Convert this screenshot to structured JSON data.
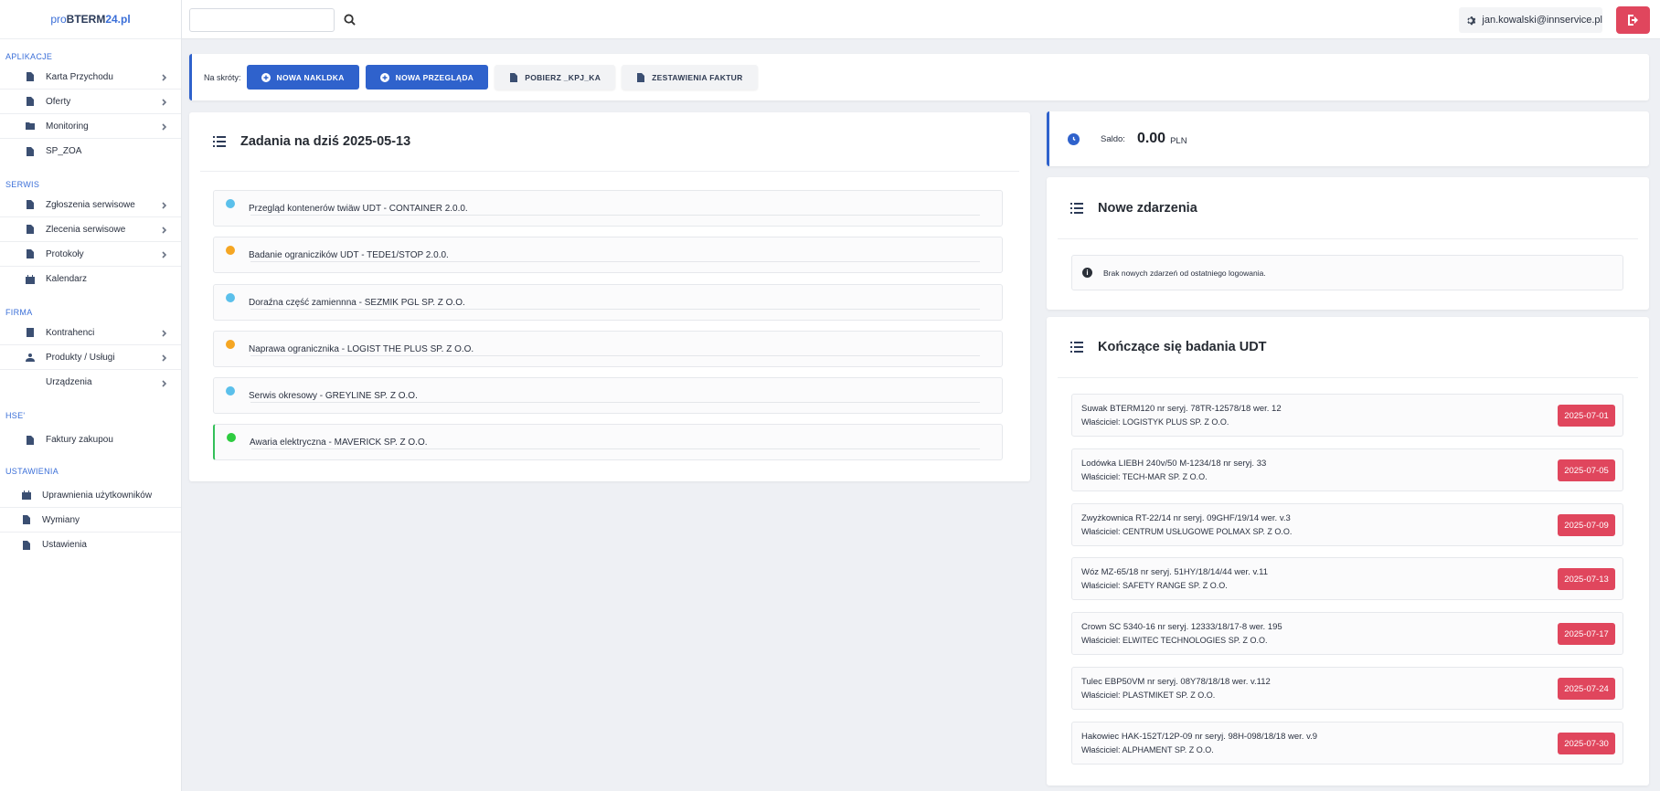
{
  "logo": {
    "pre": "pro",
    "main": "BTERM",
    "accent": "24.pl"
  },
  "sidebar": {
    "sections": [
      {
        "title": "APLIKACJE",
        "items": [
          {
            "label": "Karta Przychodu",
            "icon": "document-icon",
            "chevron": true
          },
          {
            "label": "Oferty",
            "icon": "document-icon",
            "chevron": true
          },
          {
            "label": "Monitoring",
            "icon": "folder-icon",
            "chevron": true
          },
          {
            "label": "SP_ZOA",
            "icon": "document-icon",
            "chevron": false
          }
        ]
      },
      {
        "title": "SERWIS",
        "items": [
          {
            "label": "Zgłoszenia serwisowe",
            "icon": "document-icon",
            "chevron": true
          },
          {
            "label": "Zlecenia serwisowe",
            "icon": "document-icon",
            "chevron": true
          },
          {
            "label": "Protokoły",
            "icon": "document-icon",
            "chevron": true
          },
          {
            "label": "Kalendarz",
            "icon": "calendar-icon",
            "chevron": false
          }
        ]
      },
      {
        "title": "FIRMA",
        "items": [
          {
            "label": "Kontrahenci",
            "icon": "contact-icon",
            "chevron": true
          },
          {
            "label": "Produkty / Usługi",
            "icon": "users-icon",
            "chevron": true
          },
          {
            "label": "Urządzenia",
            "icon": "",
            "chevron": true
          }
        ]
      },
      {
        "title": "HSE'",
        "items": [
          {
            "label": "Faktury zakupou",
            "icon": "document-icon",
            "chevron": false
          }
        ]
      },
      {
        "title": "USTAWIENIA",
        "items": [
          {
            "label": "Uprawnienia użytkowników",
            "icon": "calendar-icon",
            "chevron": false
          },
          {
            "label": "Wymiany",
            "icon": "document-icon",
            "chevron": false
          },
          {
            "label": "Ustawienia",
            "icon": "document-icon",
            "chevron": false
          }
        ]
      }
    ]
  },
  "header": {
    "search_placeholder": "",
    "user_email": "jan.kowalski@innservice.pl"
  },
  "shortcuts": {
    "label": "Na skróty:",
    "buttons": [
      {
        "label": "NOWA NAKLDKA",
        "style": "primary"
      },
      {
        "label": "NOWA PRZEGLĄDA",
        "style": "primary"
      },
      {
        "label": "POBIERZ _KPJ_KA",
        "style": "light"
      },
      {
        "label": "ZESTAWIENIA FAKTUR",
        "style": "light"
      }
    ]
  },
  "tasks": {
    "title": "Zadania na dziś 2025-05-13",
    "items": [
      {
        "label": "Przegląd kontenerów twiäw UDT - CONTAINER 2.0.0.",
        "color": "#5bc0eb"
      },
      {
        "label": "Badanie ograniczików UDT - TEDE1/STOP 2.0.0.",
        "color": "#f5a623"
      },
      {
        "label": "Doraźna część zamiennna - SEZMIK PGL SP. Z O.O.",
        "color": "#5bc0eb"
      },
      {
        "label": "Naprawa ogranicznika - LOGIST THE PLUS SP. Z O.O.",
        "color": "#f5a623"
      },
      {
        "label": "Serwis okresowy - GREYLINE SP. Z O.O.",
        "color": "#5bc0eb"
      },
      {
        "label": "Awaria elektryczna - MAVERICK SP. Z O.O.",
        "color": "#2ecc40"
      }
    ]
  },
  "saldo": {
    "label": "Saldo:",
    "value": "0.00",
    "currency": "PLN"
  },
  "events": {
    "title": "Nowe zdarzenia",
    "message": "Brak nowych zdarzeń od ostatniego logowania."
  },
  "udt": {
    "title": "Kończące się badania UDT",
    "items": [
      {
        "device": "Suwak BTERM120 nr seryj. 78TR-12578/18 wer. 12",
        "owner": "Właściciel: LOGISTYK PLUS SP. Z O.O.",
        "date": "2025-07-01"
      },
      {
        "device": "Lodówka LIEBH 240v/50 M-1234/18 nr seryj. 33",
        "owner": "Właściciel: TECH-MAR SP. Z O.O.",
        "date": "2025-07-05"
      },
      {
        "device": "Zwyżkownica RT-22/14 nr seryj. 09GHF/19/14 wer. v.3",
        "owner": "Właściciel: CENTRUM USŁUGOWE POLMAX SP. Z O.O.",
        "date": "2025-07-09"
      },
      {
        "device": "Wóz MZ-65/18 nr seryj. 51HY/18/14/44 wer. v.11",
        "owner": "Właściciel: SAFETY RANGE SP. Z O.O.",
        "date": "2025-07-13"
      },
      {
        "device": "Crown SC 5340-16 nr seryj. 12333/18/17-8 wer. 195",
        "owner": "Właściciel: ELWITEC TECHNOLOGIES SP. Z O.O.",
        "date": "2025-07-17"
      },
      {
        "device": "Tulec EBP50VM nr seryj. 08Y78/18/18 wer. v.112",
        "owner": "Właściciel: PLASTMIKET SP. Z O.O.",
        "date": "2025-07-24"
      },
      {
        "device": "Hakowiec HAK-152T/12P-09 nr seryj. 98H-098/18/18 wer. v.9",
        "owner": "Właściciel: ALPHAMENT SP. Z O.O.",
        "date": "2025-07-30"
      }
    ]
  }
}
